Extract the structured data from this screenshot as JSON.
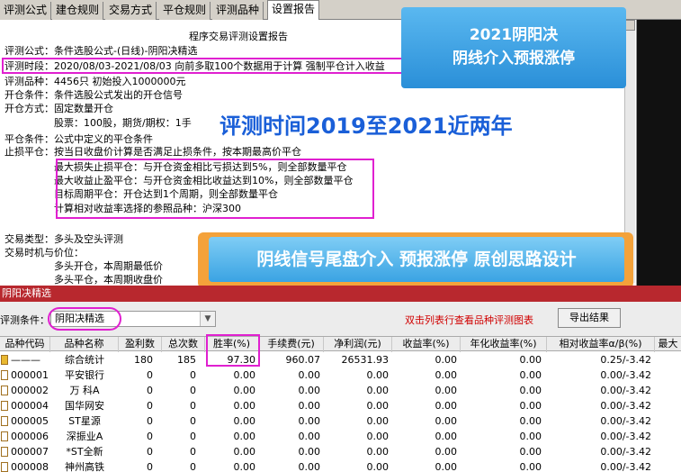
{
  "tabs": [
    "评测公式",
    "建仓规则",
    "交易方式",
    "平仓规则",
    "评测品种",
    "设置报告"
  ],
  "report": {
    "title": "程序交易评测设置报告",
    "lines": [
      "评测公式：条件选股公式-(日线)-阴阳决精选",
      "评测时段：2020/08/03-2021/08/03 向前多取100个数据用于计算 强制平仓计入收益",
      "评测品种：4456只 初始投入1000000元",
      "开仓条件：条件选股公式发出的开仓信号",
      "开仓方式：固定数量开仓",
      "　　　　　股票：100股，期货/期权：1手",
      "平仓条件：公式中定义的平仓条件",
      "止损平仓：按当日收盘价计算是否满足止损条件，按本期最高价平仓",
      "　　　　　最大损失止损平仓：与开仓资金相比亏损达到5%，则全部数量平仓",
      "　　　　　最大收益止盈平仓：与开仓资金相比收益达到10%，则全部数量平仓",
      "　　　　　目标周期平仓：开仓达到1个周期，则全部数量平仓",
      "　　　　　计算相对收益率选择的参照品种：沪深300",
      "交易类型：多头及空头评测",
      "交易时机与价位：",
      "　　　　　多头开仓，本周期最低价",
      "　　　　　多头平仓，本周期收盘价"
    ]
  },
  "callouts": {
    "blue_line1": "2021阴阳决",
    "blue_line2": "阴线介入预报涨停",
    "big_text": "评测时间2019至2021近两年",
    "orange_text": "阴线信号尾盘介入 预报涨停 原创思路设计"
  },
  "panel": {
    "title": "阴阳决精选",
    "condition_label": "评测条件：",
    "condition_value": "阴阳决精选",
    "hint": "双击列表行查看品种评测图表",
    "export_label": "导出结果"
  },
  "table": {
    "headers": [
      "品种代码",
      "品种名称",
      "盈利数",
      "总次数",
      "胜率(%)",
      "手续费(元)",
      "净利润(元)",
      "收益率(%)",
      "年化收益率(%)",
      "相对收益率α/β(%)",
      "最大"
    ],
    "rows": [
      [
        "———",
        "综合统计",
        "180",
        "185",
        "97.30",
        "960.07",
        "26531.93",
        "0.00",
        "0.00",
        "0.25/-3.42"
      ],
      [
        "000001",
        "平安银行",
        "0",
        "0",
        "0.00",
        "0.00",
        "0.00",
        "0.00",
        "0.00",
        "0.00/-3.42"
      ],
      [
        "000002",
        "万 科A",
        "0",
        "0",
        "0.00",
        "0.00",
        "0.00",
        "0.00",
        "0.00",
        "0.00/-3.42"
      ],
      [
        "000004",
        "国华网安",
        "0",
        "0",
        "0.00",
        "0.00",
        "0.00",
        "0.00",
        "0.00",
        "0.00/-3.42"
      ],
      [
        "000005",
        "ST星源",
        "0",
        "0",
        "0.00",
        "0.00",
        "0.00",
        "0.00",
        "0.00",
        "0.00/-3.42"
      ],
      [
        "000006",
        "深振业A",
        "0",
        "0",
        "0.00",
        "0.00",
        "0.00",
        "0.00",
        "0.00",
        "0.00/-3.42"
      ],
      [
        "000007",
        "*ST全新",
        "0",
        "0",
        "0.00",
        "0.00",
        "0.00",
        "0.00",
        "0.00",
        "0.00/-3.42"
      ],
      [
        "000008",
        "神州高铁",
        "0",
        "0",
        "0.00",
        "0.00",
        "0.00",
        "0.00",
        "0.00",
        "0.00/-3.42"
      ]
    ]
  },
  "colors": {
    "highlight": "#e020d0",
    "panel_bar": "#b8282e",
    "hint_red": "#d00000"
  }
}
